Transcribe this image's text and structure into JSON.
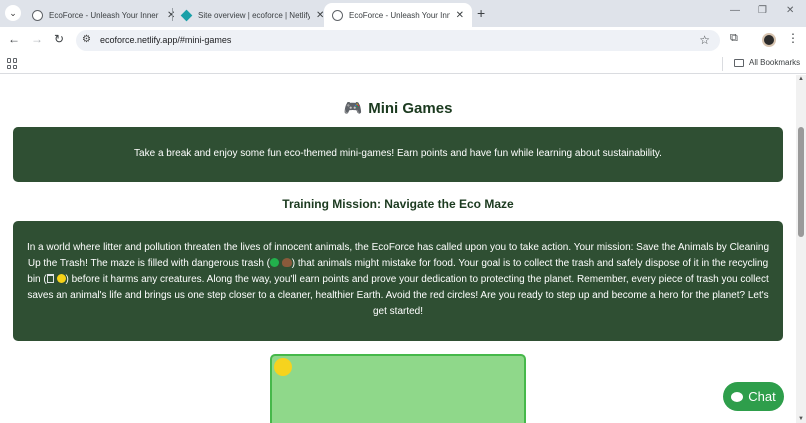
{
  "browser": {
    "tabs": [
      {
        "title": "EcoForce - Unleash Your Inner E",
        "icon": "globe-icon",
        "active": false
      },
      {
        "title": "Site overview | ecoforce | Netlify",
        "icon": "netlify-icon",
        "active": false
      },
      {
        "title": "EcoForce - Unleash Your Inner E",
        "icon": "globe-icon",
        "active": true
      }
    ],
    "new_tab_label": "+",
    "url": "ecoforce.netlify.app/#mini-games",
    "bookmarks": {
      "all_bookmarks_label": "All Bookmarks"
    }
  },
  "page": {
    "title": "Mini Games",
    "title_icon": "🎮",
    "intro": "Take a break and enjoy some fun eco-themed mini-games! Earn points and have fun while learning about sustainability.",
    "mission_heading": "Training Mission: Navigate the Eco Maze",
    "story": {
      "part1": "In a world where litter and pollution threaten the lives of innocent animals, the EcoForce has called upon you to take action. Your mission: Save the Animals by Cleaning Up the Trash! The maze is filled with dangerous trash (",
      "part2": ") that animals might mistake for food. Your goal is to collect the trash and safely dispose of it in the recycling bin (",
      "part3": ") before it harms any creatures. Along the way, you'll earn points and prove your dedication to protecting the planet. Remember, every piece of trash you collect saves an animal's life and brings us one step closer to a cleaner, healthier Earth. Avoid the red circles! Are you ready to step up and become a hero for the planet? Let's get started!"
    },
    "chat_label": "Chat"
  },
  "colors": {
    "panel_bg": "#2f4f33",
    "maze_bg": "#8fd88a",
    "maze_border": "#46b84a",
    "player": "#f6d31e",
    "chat_button": "#2e9e4b"
  }
}
